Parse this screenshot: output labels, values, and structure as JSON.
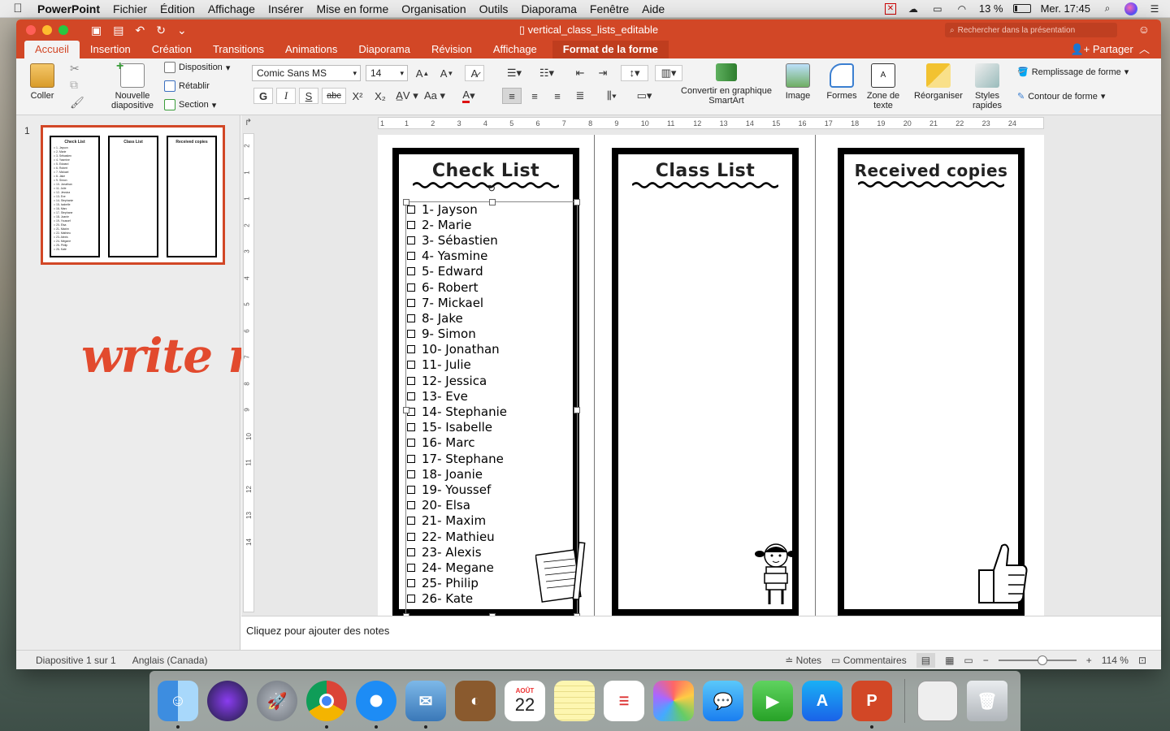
{
  "menubar": {
    "items": [
      "PowerPoint",
      "Fichier",
      "Édition",
      "Affichage",
      "Insérer",
      "Mise en forme",
      "Organisation",
      "Outils",
      "Diaporama",
      "Fenêtre",
      "Aide"
    ],
    "battery": "13 %",
    "clock": "Mer. 17:45"
  },
  "window": {
    "title": "vertical_class_lists_editable",
    "search_placeholder": "Rechercher dans la présentation",
    "tabs": [
      "Accueil",
      "Insertion",
      "Création",
      "Transitions",
      "Animations",
      "Diaporama",
      "Révision",
      "Affichage"
    ],
    "context_tab": "Format de la forme",
    "share": "Partager"
  },
  "ribbon": {
    "paste": "Coller",
    "new_slide": "Nouvelle diapositive",
    "layout": "Disposition",
    "reset": "Rétablir",
    "section": "Section",
    "font_name": "Comic Sans MS",
    "font_size": "14",
    "smartart": "Convertir en graphique SmartArt",
    "image": "Image",
    "shapes": "Formes",
    "textbox": "Zone de texte",
    "arrange": "Réorganiser",
    "quick_styles": "Styles rapides",
    "shape_fill": "Remplissage de forme",
    "shape_outline": "Contour de forme",
    "bold": "G",
    "italic": "I",
    "underline": "S",
    "strike": "abc"
  },
  "thumbnails": {
    "slide_number": "1"
  },
  "annotation": "write names",
  "ruler": {
    "h_labels": [
      "1",
      "1",
      "2",
      "3",
      "4",
      "5",
      "6",
      "7",
      "8",
      "9",
      "10",
      "11",
      "12",
      "13",
      "14",
      "15",
      "16",
      "17",
      "18",
      "19",
      "20",
      "21",
      "22",
      "23",
      "24"
    ],
    "v_labels": [
      "2",
      "1",
      "1",
      "2",
      "3",
      "4",
      "5",
      "6",
      "7",
      "8",
      "9",
      "10",
      "11",
      "12",
      "13",
      "14"
    ]
  },
  "slide": {
    "panels": [
      {
        "title": "Check List"
      },
      {
        "title": "Class List"
      },
      {
        "title": "Received copies"
      }
    ],
    "names": [
      "1- Jayson",
      "2- Marie",
      "3- Sébastien",
      "4- Yasmine",
      "5- Edward",
      "6- Robert",
      "7- Mickael",
      "8- Jake",
      "9- Simon",
      "10- Jonathan",
      "11- Julie",
      "12- Jessica",
      "13- Eve",
      "14- Stephanie",
      "15- Isabelle",
      "16- Marc",
      "17- Stephane",
      "18- Joanie",
      "19- Youssef",
      "20- Elsa",
      "21- Maxim",
      "22- Mathieu",
      "23- Alexis",
      "24- Megane",
      "25- Philip",
      "26- Kate"
    ]
  },
  "notes_placeholder": "Cliquez pour ajouter des notes",
  "statusbar": {
    "slide_info": "Diapositive 1 sur 1",
    "language": "Anglais (Canada)",
    "notes": "Notes",
    "comments": "Commentaires",
    "zoom": "114 %"
  },
  "dock": {
    "calendar_month": "AOÛT",
    "calendar_day": "22"
  },
  "colors": {
    "accent": "#d24726",
    "annotation": "#e24a2e"
  }
}
